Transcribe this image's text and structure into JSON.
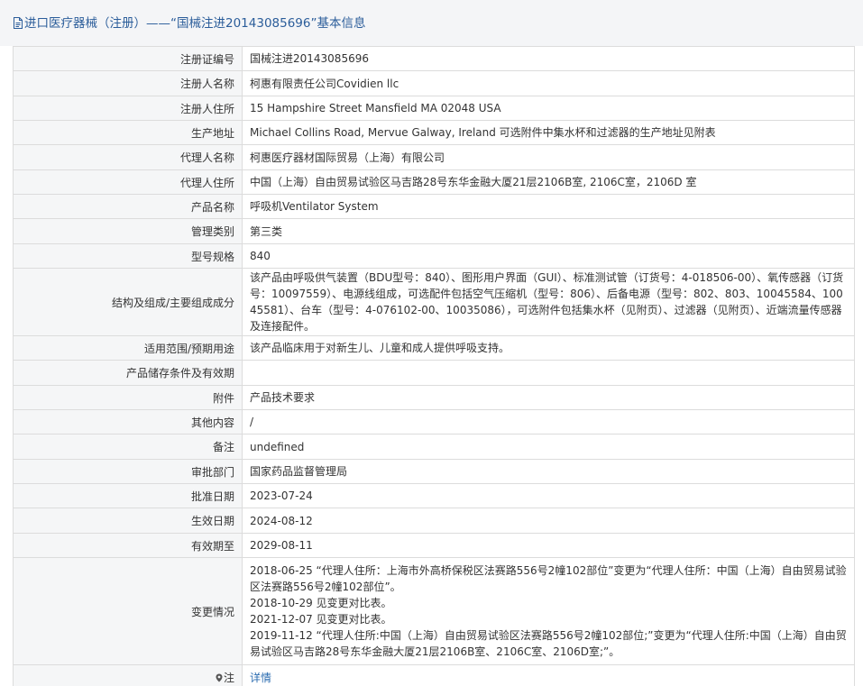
{
  "header": {
    "title": "进口医疗器械（注册）——“国械注进20143085696”基本信息",
    "icon": "document-icon"
  },
  "rows": [
    {
      "label": "注册证编号",
      "value": "国械注进20143085696"
    },
    {
      "label": "注册人名称",
      "value": "柯惠有限责任公司Covidien llc"
    },
    {
      "label": "注册人住所",
      "value": "15 Hampshire Street Mansfield MA 02048 USA"
    },
    {
      "label": "生产地址",
      "value": "Michael Collins Road, Mervue Galway, Ireland 可选附件中集水杯和过滤器的生产地址见附表"
    },
    {
      "label": "代理人名称",
      "value": "柯惠医疗器材国际贸易（上海）有限公司"
    },
    {
      "label": "代理人住所",
      "value": "中国（上海）自由贸易试验区马吉路28号东华金融大厦21层2106B室, 2106C室，2106D 室"
    },
    {
      "label": "产品名称",
      "value": "呼吸机Ventilator System"
    },
    {
      "label": "管理类别",
      "value": "第三类"
    },
    {
      "label": "型号规格",
      "value": "840"
    },
    {
      "label": "结构及组成/主要组成成分",
      "value": "该产品由呼吸供气装置（BDU型号：840）、图形用户界面（GUI）、标准测试管（订货号：4-018506-00）、氧传感器（订货号：10097559）、电源线组成，可选配件包括空气压缩机（型号：806）、后备电源（型号：802、803、10045584、10045581）、台车（型号：4-076102-00、10035086），可选附件包括集水杯（见附页）、过滤器（见附页）、近端流量传感器及连接配件。"
    },
    {
      "label": "适用范围/预期用途",
      "value": "该产品临床用于对新生儿、儿童和成人提供呼吸支持。"
    },
    {
      "label": "产品储存条件及有效期",
      "value": ""
    },
    {
      "label": "附件",
      "value": "产品技术要求"
    },
    {
      "label": "其他内容",
      "value": "/"
    },
    {
      "label": "备注",
      "value": "undefined"
    },
    {
      "label": "审批部门",
      "value": "国家药品监督管理局"
    },
    {
      "label": "批准日期",
      "value": "2023-07-24"
    },
    {
      "label": "生效日期",
      "value": "2024-08-12"
    },
    {
      "label": "有效期至",
      "value": "2029-08-11"
    }
  ],
  "changes": {
    "label": "变更情况",
    "lines": [
      "2018-06-25 “代理人住所：上海市外高桥保税区法赛路556号2幢102部位”变更为“代理人住所：中国（上海）自由贸易试验区法赛路556号2幢102部位”。",
      "2018-10-29 见变更对比表。",
      "2021-12-07 见变更对比表。",
      "2019-11-12 “代理人住所:中国（上海）自由贸易试验区法赛路556号2幢102部位;”变更为“代理人住所:中国（上海）自由贸易试验区马吉路28号东华金融大厦21层2106B室、2106C室、2106D室;”。"
    ]
  },
  "note": {
    "label": "注",
    "icon": "location-pin-icon",
    "link_text": "详情"
  },
  "colors": {
    "title_text": "#2b5d9a",
    "title_bar_bg": "#f4f5f7",
    "label_bg": "#f5f6f7",
    "border": "#dcdcdc",
    "link": "#2b6cb0"
  }
}
